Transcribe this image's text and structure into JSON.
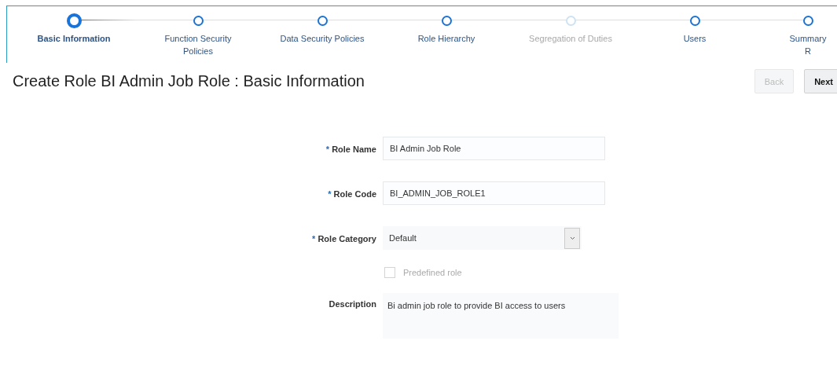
{
  "train": [
    {
      "lines": [
        "Basic Information"
      ],
      "selected": true,
      "disabled": false
    },
    {
      "lines": [
        "Function Security",
        "Policies"
      ],
      "selected": false,
      "disabled": false
    },
    {
      "lines": [
        "Data Security Policies"
      ],
      "selected": false,
      "disabled": false
    },
    {
      "lines": [
        "Role Hierarchy"
      ],
      "selected": false,
      "disabled": false
    },
    {
      "lines": [
        "Segregation of Duties"
      ],
      "selected": false,
      "disabled": true
    },
    {
      "lines": [
        "Users"
      ],
      "selected": false,
      "disabled": false
    },
    {
      "lines": [
        "Summary",
        "R"
      ],
      "selected": false,
      "disabled": false
    }
  ],
  "title": "Create Role BI Admin Job Role : Basic Information",
  "buttons": [
    {
      "label": "Back",
      "disabled": true
    },
    {
      "label": "Next",
      "disabled": false
    }
  ],
  "fields": [
    {
      "kind": "text",
      "required_mark": "*",
      "label": "Role Name",
      "value": "BI Admin Job Role"
    },
    {
      "kind": "text",
      "required_mark": "*",
      "label": "Role Code",
      "value": "BI_ADMIN_JOB_ROLE1"
    },
    {
      "kind": "select",
      "required_mark": "*",
      "label": "Role Category",
      "value": "Default"
    },
    {
      "kind": "checkbox",
      "label": "Predefined role",
      "checked": false,
      "disabled": true
    },
    {
      "kind": "textarea",
      "label": "Description",
      "value": "Bi admin job role to provide BI access to users"
    }
  ]
}
